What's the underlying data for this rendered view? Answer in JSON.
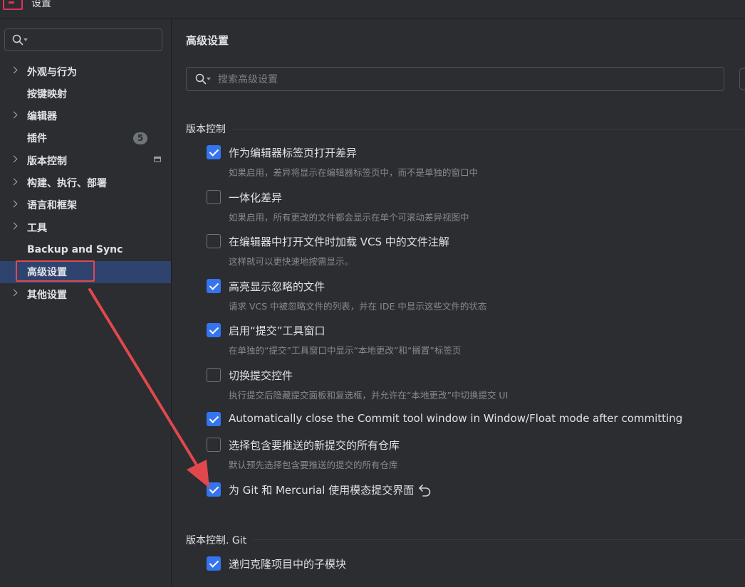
{
  "window": {
    "title": "设置"
  },
  "sidebar": {
    "items": [
      {
        "label": "外观与行为",
        "expandable": true
      },
      {
        "label": "按键映射",
        "expandable": false
      },
      {
        "label": "编辑器",
        "expandable": true
      },
      {
        "label": "插件",
        "expandable": false,
        "badge": "5"
      },
      {
        "label": "版本控制",
        "expandable": true,
        "window_icon": "window-icon"
      },
      {
        "label": "构建、执行、部署",
        "expandable": true
      },
      {
        "label": "语言和框架",
        "expandable": true
      },
      {
        "label": "工具",
        "expandable": true
      },
      {
        "label": "Backup and Sync",
        "expandable": false
      },
      {
        "label": "高级设置",
        "expandable": false,
        "selected": true
      },
      {
        "label": "其他设置",
        "expandable": true
      }
    ]
  },
  "main": {
    "title": "高级设置",
    "search": {
      "placeholder": "搜索高级设置",
      "value": ""
    }
  },
  "sections": [
    {
      "title": "版本控制",
      "options": [
        {
          "label": "作为编辑器标签页打开差异",
          "description": "如果启用，差异将显示在编辑器标签页中，而不是单独的窗口中",
          "checked": true
        },
        {
          "label": "一体化差异",
          "description": "如果启用，所有更改的文件都会显示在单个可滚动差异视图中",
          "checked": false
        },
        {
          "label": "在编辑器中打开文件时加载 VCS 中的文件注解",
          "description": "这样就可以更快速地按需显示。",
          "checked": false
        },
        {
          "label": "高亮显示忽略的文件",
          "description": "请求 VCS 中被忽略文件的列表，并在 IDE 中显示这些文件的状态",
          "checked": true
        },
        {
          "label": "启用“提交”工具窗口",
          "description": "在单独的“提交”工具窗口中显示“本地更改”和“搁置”标签页",
          "checked": true
        },
        {
          "label": "切换提交控件",
          "description": "执行提交后隐藏提交面板和复选框，并允许在“本地更改”中切换提交 UI",
          "checked": false
        },
        {
          "label": "Automatically close the Commit tool window in Window/Float mode after committing",
          "description": "",
          "checked": true
        },
        {
          "label": "选择包含要推送的新提交的所有仓库",
          "description": "默认预先选择包含要推送的提交的所有仓库",
          "checked": false
        },
        {
          "label": "为 Git 和 Mercurial 使用模态提交界面",
          "description": "",
          "checked": true,
          "revert_icon": "undo-icon"
        }
      ]
    },
    {
      "title": "版本控制. Git",
      "options": [
        {
          "label": "递归克隆项目中的子模块",
          "description": "",
          "checked": true
        }
      ]
    }
  ],
  "colors": {
    "background": "#2b2d30",
    "accent": "#3574f0",
    "selection": "#2e436e",
    "annotation": "#e0484e"
  }
}
